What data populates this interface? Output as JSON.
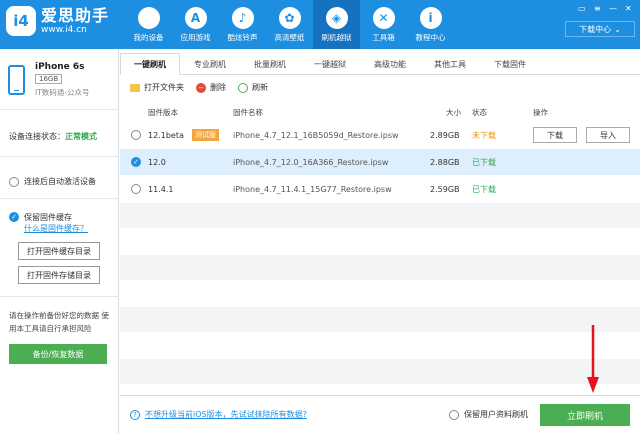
{
  "app": {
    "logo_mark": "i4",
    "name": "爱思助手",
    "url": "www.i4.cn",
    "download_center": "下载中心",
    "nav": [
      {
        "label": "我的设备",
        "icon": "apple-icon",
        "glyph": ""
      },
      {
        "label": "应用游戏",
        "icon": "app-store-icon",
        "glyph": "A"
      },
      {
        "label": "酷炫铃声",
        "icon": "bell-icon",
        "glyph": "♪"
      },
      {
        "label": "高清壁纸",
        "icon": "flower-icon",
        "glyph": "✿"
      },
      {
        "label": "刷机越狱",
        "icon": "dropbox-icon",
        "glyph": "◈"
      },
      {
        "label": "工具箱",
        "icon": "tools-icon",
        "glyph": "✕"
      },
      {
        "label": "教程中心",
        "icon": "info-icon",
        "glyph": "i"
      }
    ]
  },
  "sidebar": {
    "device_name": "iPhone 6s",
    "capacity": "16GB",
    "sub": "IT数码通-公众号",
    "status_label": "设备连接状态：",
    "status_value": "正常模式",
    "auto_activate": "连接后自动激活设备",
    "keep_cache": "保留固件缓存",
    "keep_cache_link": "什么是固件缓存？",
    "open_cache_dir": "打开固件缓存目录",
    "open_storage_dir": "打开固件存储目录",
    "note": "请在操作前备份好您的数据 使用本工具请自行承担风险",
    "backup_button": "备份/恢复数据"
  },
  "tabs": [
    "一键刷机",
    "专业刷机",
    "批量刷机",
    "一键越狱",
    "高级功能",
    "其他工具",
    "下载固件"
  ],
  "toolbar": {
    "open_folder": "打开文件夹",
    "delete": "删除",
    "refresh": "刷新"
  },
  "table": {
    "headers": {
      "version": "固件版本",
      "name": "固件名称",
      "size": "大小",
      "status": "状态",
      "action": "操作"
    },
    "rows": [
      {
        "version": "12.1beta",
        "tag": "测试版",
        "name": "iPhone_4.7_12.1_16B5059d_Restore.ipsw",
        "size": "2.89GB",
        "status": "未下载",
        "status_type": "warn",
        "download": "下载",
        "import": "导入"
      },
      {
        "version": "12.0",
        "tag": "",
        "name": "iPhone_4.7_12.0_16A366_Restore.ipsw",
        "size": "2.88GB",
        "status": "已下载",
        "status_type": "ok"
      },
      {
        "version": "11.4.1",
        "tag": "",
        "name": "iPhone_4.7_11.4.1_15G77_Restore.ipsw",
        "size": "2.59GB",
        "status": "已下载",
        "status_type": "ok"
      }
    ]
  },
  "footer": {
    "question": "不想升级当前iOS版本，先试试抹除所有数据?",
    "keep_data": "保留用户资料刷机",
    "flash_button": "立即刷机"
  },
  "colors": {
    "brand": "#1e8fe0",
    "green": "#4cae52",
    "warn": "#f0940a",
    "arrow": "#e8131a"
  }
}
